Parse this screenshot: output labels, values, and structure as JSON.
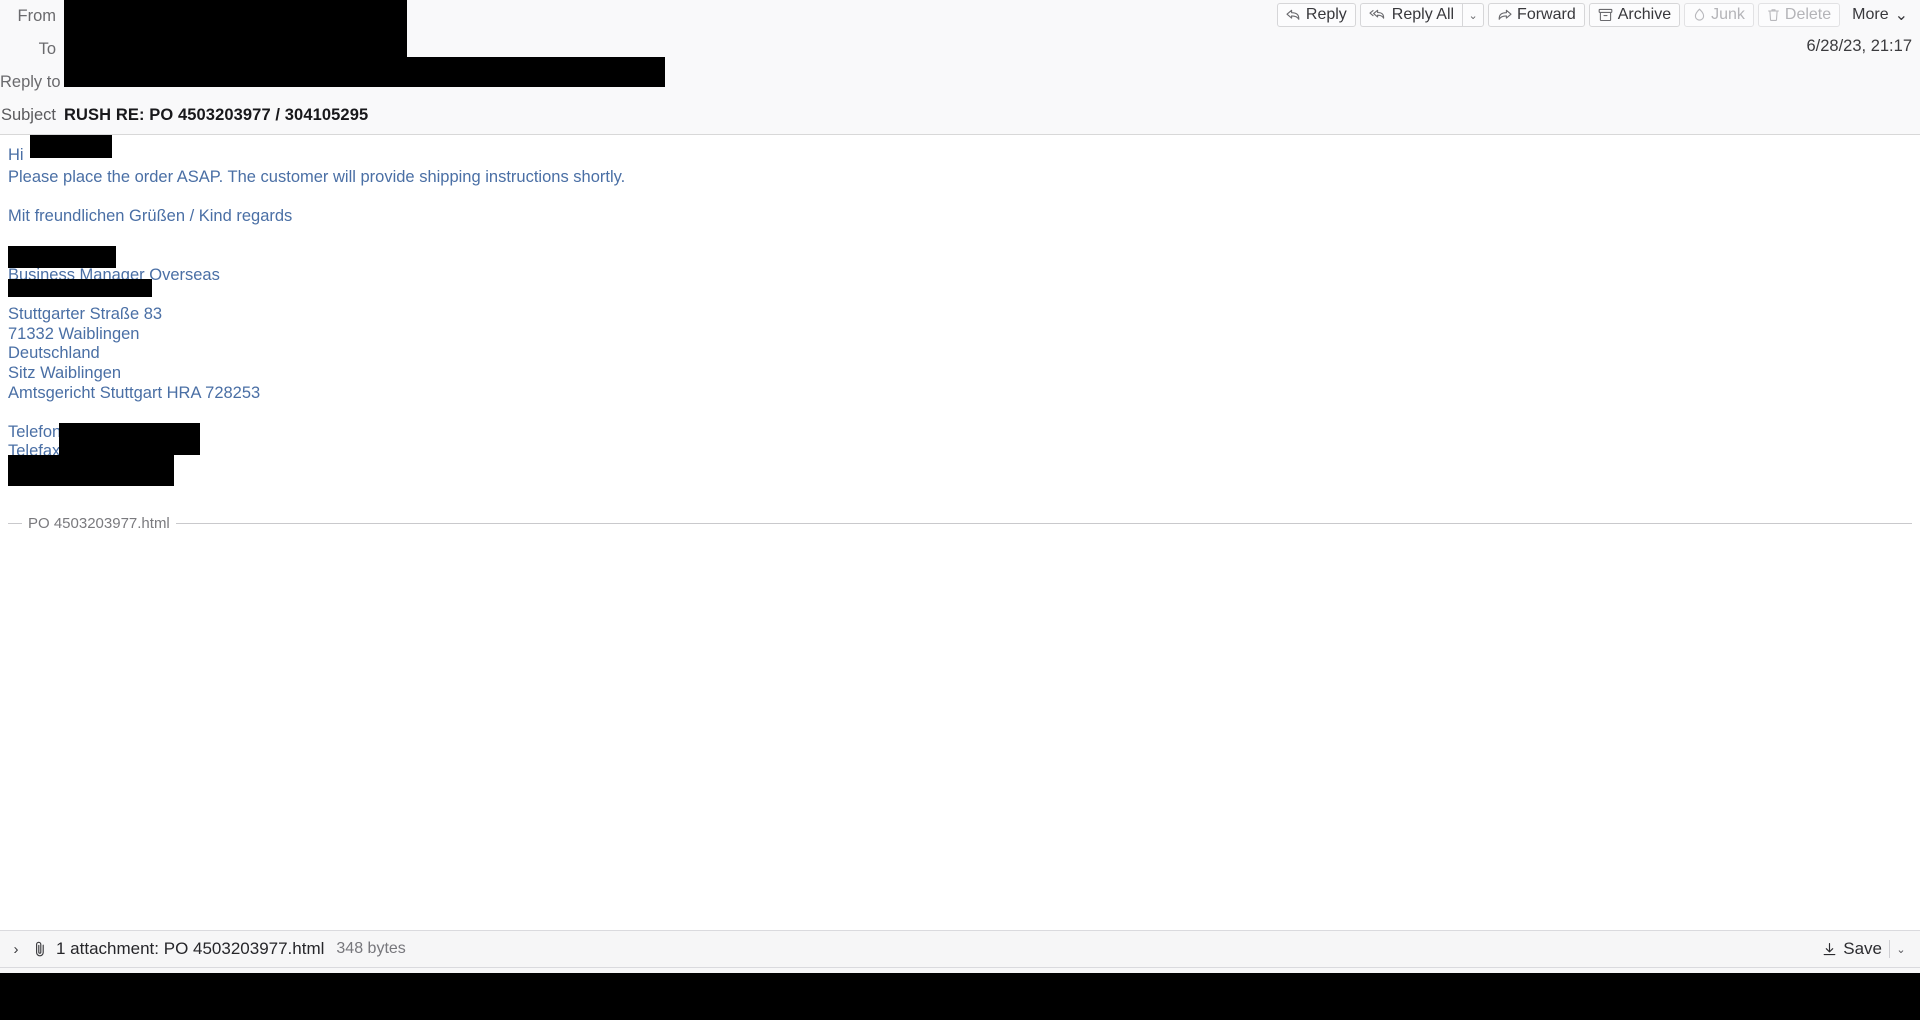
{
  "header": {
    "fields": [
      {
        "label": "From",
        "redacted": true
      },
      {
        "label": "To",
        "redacted": true
      },
      {
        "label": "Reply to",
        "redacted": true
      },
      {
        "label": "Subject",
        "value": "RUSH RE: PO 4503203977 / 304105295",
        "redacted": false
      }
    ],
    "date": "6/28/23, 21:17"
  },
  "toolbar": {
    "reply_label": "Reply",
    "reply_all_label": "Reply All",
    "reply_all_caret": "⌄",
    "forward_label": "Forward",
    "archive_label": "Archive",
    "junk_label": "Junk",
    "delete_label": "Delete",
    "more_label": "More",
    "more_caret": "⌄",
    "icons": {
      "reply": "reply-icon",
      "reply_all": "reply-all-icon",
      "forward": "forward-icon",
      "archive": "archive-box-icon",
      "junk": "flame-icon",
      "delete": "trash-icon"
    },
    "disabled": [
      "Junk",
      "Delete"
    ]
  },
  "body": {
    "greeting": "Hi",
    "paragraph": "Please place the order ASAP. The customer will provide shipping instructions shortly.",
    "closing": "Mit freundlichen Grüßen / Kind regards",
    "signature": {
      "job_title": "Business Manager Overseas",
      "address": [
        "Stuttgarter Straße 83",
        "71332 Waiblingen",
        "Deutschland",
        "Sitz Waiblingen",
        "Amtsgericht Stuttgart HRA 728253"
      ],
      "phone_label": "Telefon",
      "fax_label": "Telefax"
    },
    "attachment_separator": "PO 4503203977.html"
  },
  "attachment_bar": {
    "expand_chevron": "›",
    "paperclip_icon": "paperclip-icon",
    "summary": "1 attachment: PO 4503203977.html",
    "size": "348 bytes",
    "save_label": "Save",
    "save_caret": "⌄",
    "save_icon": "download-icon"
  },
  "colors": {
    "header_bg": "#f9f9fa",
    "body_text": "#4a6fa5",
    "redaction": "#000000",
    "toolbar_btn_bg": "#fcfcfd",
    "disabled_text": "#b4b4b8"
  }
}
